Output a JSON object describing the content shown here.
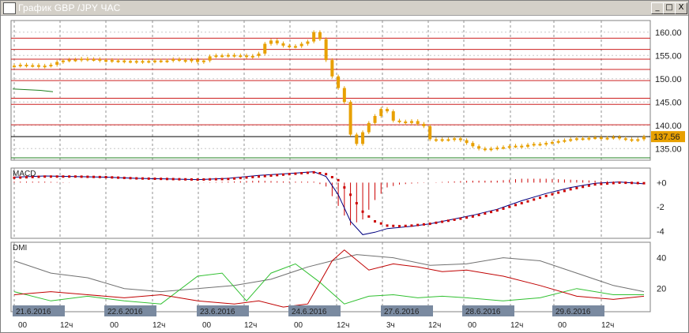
{
  "window": {
    "title": "График GBP /JPY ЧАС",
    "buttons": {
      "minimize": "_",
      "maximize": "□",
      "close": "X"
    }
  },
  "chart_data": {
    "type": "line",
    "symbol": "GBP/JPY",
    "timeframe": "ЧАС",
    "price_panel": {
      "yticks": [
        135,
        140,
        145,
        150,
        155,
        160
      ],
      "ytick_labels": [
        "135.00",
        "140.00",
        "145.00",
        "150.00",
        "155.00",
        "160.00"
      ],
      "ylim": [
        132.5,
        162.5
      ],
      "current_price": 137.56,
      "current_price_label": "137.56",
      "red_levels": [
        158.7,
        156.3,
        154.2,
        152.0,
        149.6,
        145.8,
        144.5,
        140.1
      ],
      "green_levels": [
        133.0
      ],
      "candles": [
        [
          0,
          152.8
        ],
        [
          1,
          153.0
        ],
        [
          2,
          152.8
        ],
        [
          3,
          152.9
        ],
        [
          4,
          152.6
        ],
        [
          5,
          152.8
        ],
        [
          6,
          153.0
        ],
        [
          7,
          153.6
        ],
        [
          8,
          153.9
        ],
        [
          9,
          154.1
        ],
        [
          10,
          154.0
        ],
        [
          11,
          154.3
        ],
        [
          12,
          154.1
        ],
        [
          13,
          154.2
        ],
        [
          14,
          153.9
        ],
        [
          15,
          154.0
        ],
        [
          16,
          153.8
        ],
        [
          17,
          153.9
        ],
        [
          18,
          153.7
        ],
        [
          19,
          153.8
        ],
        [
          20,
          153.6
        ],
        [
          21,
          153.8
        ],
        [
          22,
          153.7
        ],
        [
          23,
          153.9
        ],
        [
          24,
          153.8
        ],
        [
          25,
          153.9
        ],
        [
          26,
          154.2
        ],
        [
          27,
          154.0
        ],
        [
          28,
          153.8
        ],
        [
          29,
          154.1
        ],
        [
          30,
          153.6
        ],
        [
          31,
          153.9
        ],
        [
          32,
          154.8
        ],
        [
          33,
          155.0
        ],
        [
          34,
          154.9
        ],
        [
          35,
          155.1
        ],
        [
          36,
          154.9
        ],
        [
          37,
          155.0
        ],
        [
          38,
          154.7
        ],
        [
          39,
          154.9
        ],
        [
          40,
          155.4
        ],
        [
          41,
          157.5
        ],
        [
          42,
          158.2
        ],
        [
          43,
          157.6
        ],
        [
          44,
          157.1
        ],
        [
          45,
          156.9
        ],
        [
          46,
          157.0
        ],
        [
          47,
          157.5
        ],
        [
          48,
          158.0
        ],
        [
          49,
          160.0
        ],
        [
          50,
          158.5
        ],
        [
          51,
          154.0
        ],
        [
          52,
          150.5
        ],
        [
          53,
          148.0
        ],
        [
          54,
          145.0
        ],
        [
          55,
          138.0
        ],
        [
          56,
          136.0
        ],
        [
          57,
          138.5
        ],
        [
          58,
          140.5
        ],
        [
          59,
          142.0
        ],
        [
          60,
          143.5
        ],
        [
          61,
          143.0
        ],
        [
          62,
          141.0
        ],
        [
          63,
          140.8
        ],
        [
          64,
          140.5
        ],
        [
          65,
          140.9
        ],
        [
          66,
          140.3
        ],
        [
          67,
          139.8
        ],
        [
          68,
          137.0
        ],
        [
          69,
          136.8
        ],
        [
          70,
          137.0
        ],
        [
          71,
          136.9
        ],
        [
          72,
          137.2
        ],
        [
          73,
          136.8
        ],
        [
          74,
          136.2
        ],
        [
          75,
          135.5
        ],
        [
          76,
          135.0
        ],
        [
          77,
          134.8
        ],
        [
          78,
          135.0
        ],
        [
          79,
          135.2
        ],
        [
          80,
          135.3
        ],
        [
          81,
          135.5
        ],
        [
          82,
          135.6
        ],
        [
          83,
          135.4
        ],
        [
          84,
          135.8
        ],
        [
          85,
          136.0
        ],
        [
          86,
          135.9
        ],
        [
          87,
          136.2
        ],
        [
          88,
          136.4
        ],
        [
          89,
          136.6
        ],
        [
          90,
          136.8
        ],
        [
          91,
          137.0
        ],
        [
          92,
          137.2
        ],
        [
          93,
          137.1
        ],
        [
          94,
          137.3
        ],
        [
          95,
          137.4
        ],
        [
          96,
          137.2
        ],
        [
          97,
          137.3
        ],
        [
          98,
          137.5
        ],
        [
          99,
          137.2
        ],
        [
          100,
          137.0
        ],
        [
          101,
          136.8
        ],
        [
          102,
          137.0
        ],
        [
          103,
          137.56
        ]
      ]
    },
    "macd_panel": {
      "label": "MACD",
      "yticks": [
        0,
        -2,
        -4
      ],
      "ytick_labels": [
        "+0",
        "-2",
        "-4"
      ],
      "ylim": [
        -4.6,
        1.2
      ],
      "macd_line": [
        [
          0,
          0.45
        ],
        [
          5,
          0.55
        ],
        [
          10,
          0.5
        ],
        [
          15,
          0.45
        ],
        [
          20,
          0.35
        ],
        [
          25,
          0.3
        ],
        [
          30,
          0.25
        ],
        [
          35,
          0.35
        ],
        [
          40,
          0.6
        ],
        [
          45,
          0.75
        ],
        [
          49,
          0.9
        ],
        [
          51,
          0.5
        ],
        [
          53,
          -1.0
        ],
        [
          55,
          -3.2
        ],
        [
          57,
          -4.3
        ],
        [
          59,
          -4.1
        ],
        [
          61,
          -3.8
        ],
        [
          63,
          -3.7
        ],
        [
          65,
          -3.6
        ],
        [
          68,
          -3.4
        ],
        [
          71,
          -3.1
        ],
        [
          75,
          -2.7
        ],
        [
          79,
          -2.2
        ],
        [
          83,
          -1.5
        ],
        [
          87,
          -0.9
        ],
        [
          91,
          -0.4
        ],
        [
          95,
          -0.05
        ],
        [
          99,
          0.05
        ],
        [
          103,
          -0.1
        ]
      ],
      "signal_line": [
        [
          0,
          0.4
        ],
        [
          5,
          0.5
        ],
        [
          10,
          0.5
        ],
        [
          15,
          0.45
        ],
        [
          20,
          0.35
        ],
        [
          25,
          0.3
        ],
        [
          30,
          0.25
        ],
        [
          35,
          0.3
        ],
        [
          40,
          0.5
        ],
        [
          45,
          0.7
        ],
        [
          49,
          0.85
        ],
        [
          51,
          0.7
        ],
        [
          53,
          0.2
        ],
        [
          55,
          -1.0
        ],
        [
          57,
          -2.4
        ],
        [
          59,
          -3.2
        ],
        [
          61,
          -3.55
        ],
        [
          63,
          -3.6
        ],
        [
          65,
          -3.55
        ],
        [
          68,
          -3.4
        ],
        [
          71,
          -3.15
        ],
        [
          75,
          -2.8
        ],
        [
          79,
          -2.3
        ],
        [
          83,
          -1.7
        ],
        [
          87,
          -1.1
        ],
        [
          91,
          -0.55
        ],
        [
          95,
          -0.15
        ],
        [
          99,
          0.0
        ],
        [
          103,
          -0.05
        ]
      ]
    },
    "dmi_panel": {
      "label": "DMI",
      "yticks": [
        20,
        40
      ],
      "ytick_labels": [
        "20",
        "40"
      ],
      "ylim": [
        5,
        50
      ],
      "adx_gray": [
        [
          0,
          38
        ],
        [
          6,
          30
        ],
        [
          12,
          27
        ],
        [
          18,
          20
        ],
        [
          24,
          18
        ],
        [
          30,
          20
        ],
        [
          36,
          22
        ],
        [
          42,
          26
        ],
        [
          48,
          34
        ],
        [
          52,
          38
        ],
        [
          56,
          42
        ],
        [
          62,
          40
        ],
        [
          68,
          35
        ],
        [
          74,
          36
        ],
        [
          80,
          40
        ],
        [
          86,
          38
        ],
        [
          92,
          30
        ],
        [
          98,
          22
        ],
        [
          103,
          18
        ]
      ],
      "plus_di_green": [
        [
          0,
          18
        ],
        [
          6,
          12
        ],
        [
          12,
          15
        ],
        [
          18,
          12
        ],
        [
          24,
          10
        ],
        [
          30,
          28
        ],
        [
          34,
          30
        ],
        [
          38,
          12
        ],
        [
          42,
          30
        ],
        [
          46,
          36
        ],
        [
          50,
          24
        ],
        [
          54,
          10
        ],
        [
          58,
          15
        ],
        [
          62,
          16
        ],
        [
          66,
          14
        ],
        [
          70,
          15
        ],
        [
          74,
          14
        ],
        [
          80,
          12
        ],
        [
          86,
          14
        ],
        [
          92,
          20
        ],
        [
          98,
          16
        ],
        [
          103,
          16
        ]
      ],
      "minus_di_red": [
        [
          0,
          16
        ],
        [
          6,
          18
        ],
        [
          12,
          16
        ],
        [
          18,
          14
        ],
        [
          24,
          16
        ],
        [
          30,
          12
        ],
        [
          36,
          10
        ],
        [
          40,
          12
        ],
        [
          44,
          8
        ],
        [
          48,
          10
        ],
        [
          52,
          38
        ],
        [
          54,
          45
        ],
        [
          58,
          32
        ],
        [
          62,
          36
        ],
        [
          66,
          34
        ],
        [
          70,
          31
        ],
        [
          74,
          32
        ],
        [
          80,
          28
        ],
        [
          86,
          22
        ],
        [
          92,
          15
        ],
        [
          98,
          13
        ],
        [
          103,
          15
        ]
      ]
    },
    "date_labels": [
      "21.6.2016",
      "22.6.2016",
      "23.6.2016",
      "24.6.2016",
      "27.6.2016",
      "28.6.2016",
      "29.6.2016"
    ],
    "date_day_index": [
      0,
      1,
      2,
      3,
      4,
      5,
      6
    ],
    "hour_labels": [
      [
        "00",
        "12ч"
      ],
      [
        "00",
        "12ч"
      ],
      [
        "00",
        "12ч"
      ],
      [
        "00",
        "12ч"
      ],
      [
        "3ч",
        "12ч"
      ],
      [
        "00",
        "12ч"
      ],
      [
        "00",
        "12ч"
      ]
    ],
    "colors": {
      "candle": "#e8a000",
      "red_level": "#cc2020",
      "green_level": "#208020",
      "price_line": "#000000",
      "price_label_bg": "#e8a000",
      "macd_line": "#000080",
      "macd_signal": "#cc0000",
      "macd_hist": "#cc0000",
      "dmi_gray": "#707070",
      "dmi_green": "#30c030",
      "dmi_red": "#c00000",
      "date_box": "#7a8aa0",
      "grid": "#909090"
    },
    "grid": true
  }
}
